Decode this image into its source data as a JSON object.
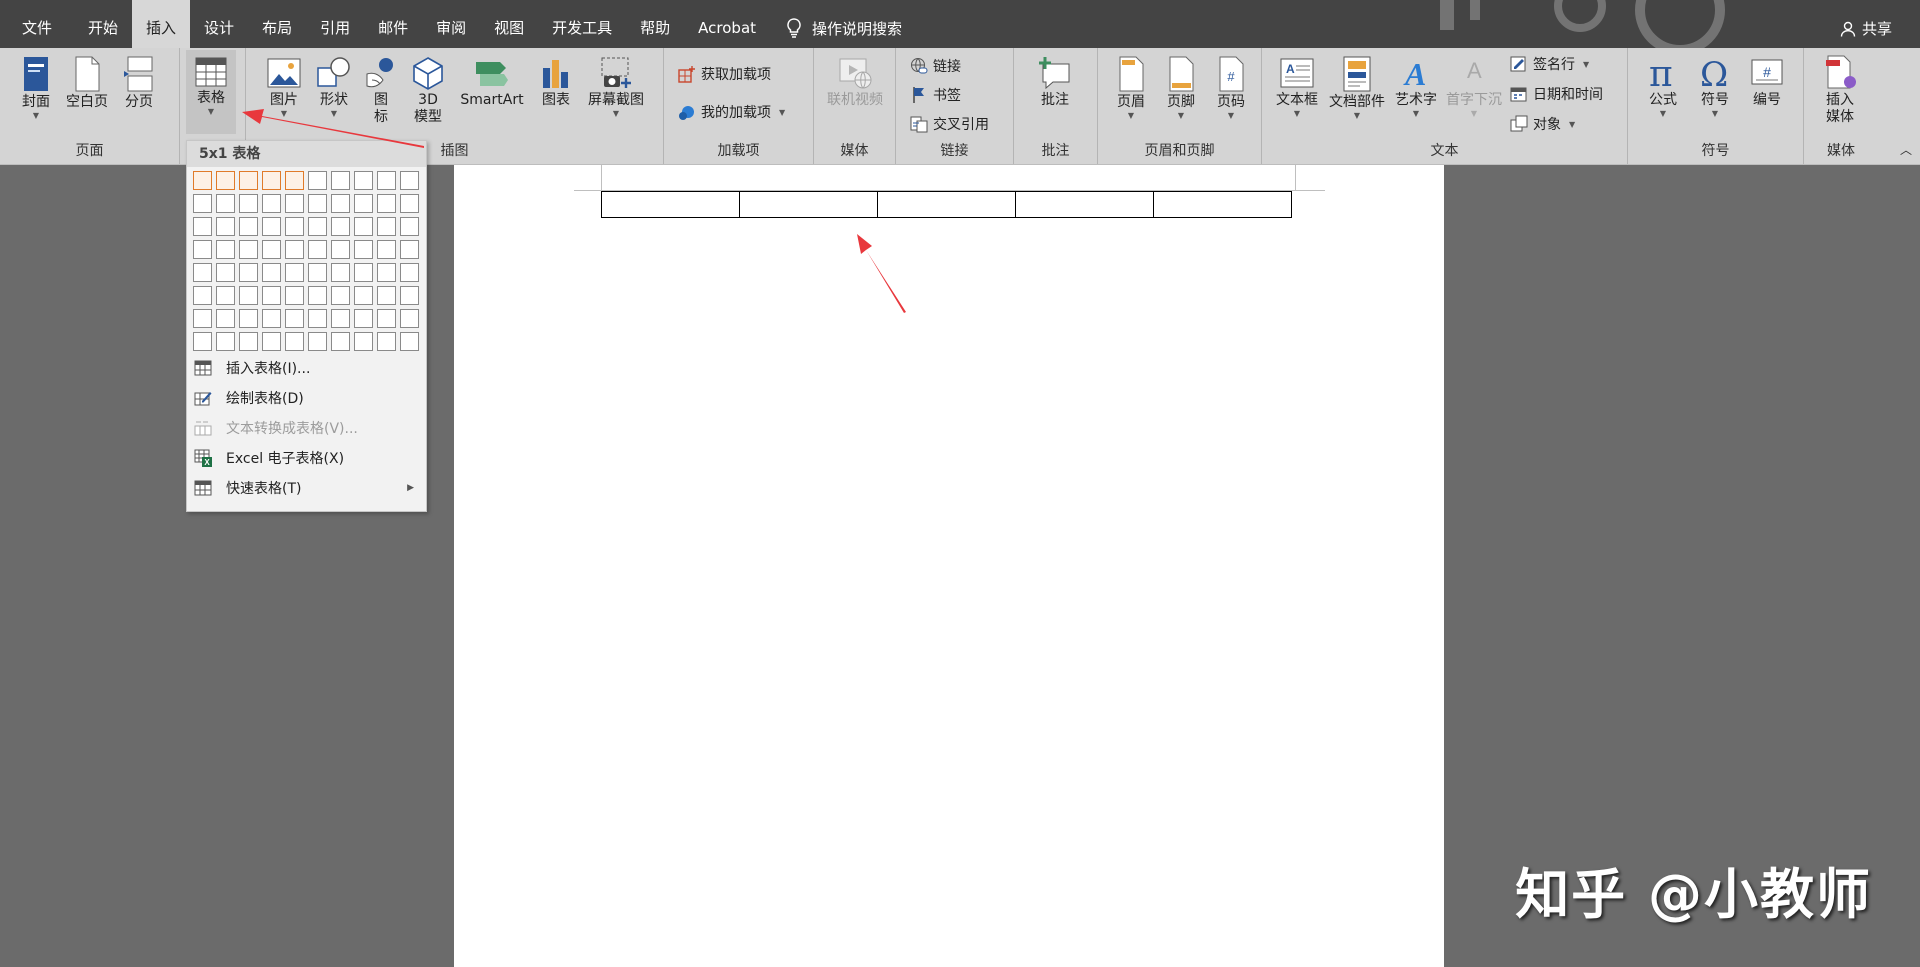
{
  "tabs": [
    "文件",
    "开始",
    "插入",
    "设计",
    "布局",
    "引用",
    "邮件",
    "审阅",
    "视图",
    "开发工具",
    "帮助",
    "Acrobat"
  ],
  "active_tab": "插入",
  "tell_me": "操作说明搜索",
  "share": "共享",
  "ribbon": {
    "pages": {
      "label": "页面",
      "cover": "封面",
      "blank": "空白页",
      "break": "分页"
    },
    "tables": {
      "table": "表格"
    },
    "illustrations": {
      "label": "插图",
      "picture": "图片",
      "shapes": "形状",
      "icons_l1": "图",
      "icons_l2": "标",
      "model_l1": "3D",
      "model_l2": "模型",
      "smartart": "SmartArt",
      "chart": "图表",
      "screenshot": "屏幕截图"
    },
    "addins": {
      "label": "加载项",
      "get": "获取加载项",
      "mine": "我的加载项"
    },
    "media1": {
      "label": "媒体",
      "online_video": "联机视频"
    },
    "links": {
      "label": "链接",
      "link": "链接",
      "bookmark": "书签",
      "crossref": "交叉引用"
    },
    "comments": {
      "label": "批注",
      "comment": "批注"
    },
    "header_footer": {
      "label": "页眉和页脚",
      "header": "页眉",
      "footer": "页脚",
      "page_number": "页码"
    },
    "text": {
      "label": "文本",
      "textbox": "文本框",
      "quickparts": "文档部件",
      "wordart": "艺术字",
      "dropcap": "首字下沉",
      "signature": "签名行",
      "datetime": "日期和时间",
      "object": "对象"
    },
    "symbols": {
      "label": "符号",
      "equation": "公式",
      "symbol": "符号",
      "number": "编号"
    },
    "media2": {
      "label": "媒体",
      "insert_media_l1": "插入",
      "insert_media_l2": "媒体"
    }
  },
  "dropdown": {
    "header": "5x1 表格",
    "grid": {
      "cols": 10,
      "rows": 8,
      "selected_cols": 5,
      "selected_rows": 1
    },
    "items": [
      {
        "label": "插入表格(I)...",
        "disabled": false,
        "submenu": false
      },
      {
        "label": "绘制表格(D)",
        "disabled": false,
        "submenu": false
      },
      {
        "label": "文本转换成表格(V)...",
        "disabled": true,
        "submenu": false
      },
      {
        "label": "Excel 电子表格(X)",
        "disabled": false,
        "submenu": false
      },
      {
        "label": "快速表格(T)",
        "disabled": false,
        "submenu": true
      }
    ]
  },
  "document": {
    "table": {
      "rows": 1,
      "cols": 5
    }
  },
  "watermark": "知乎 @小教师",
  "colors": {
    "tabbar": "#444444",
    "ribbon": "#d4d4d4",
    "accent": "#2b579a",
    "arrow": "#e8383d",
    "highlight": "#e07b2a"
  }
}
